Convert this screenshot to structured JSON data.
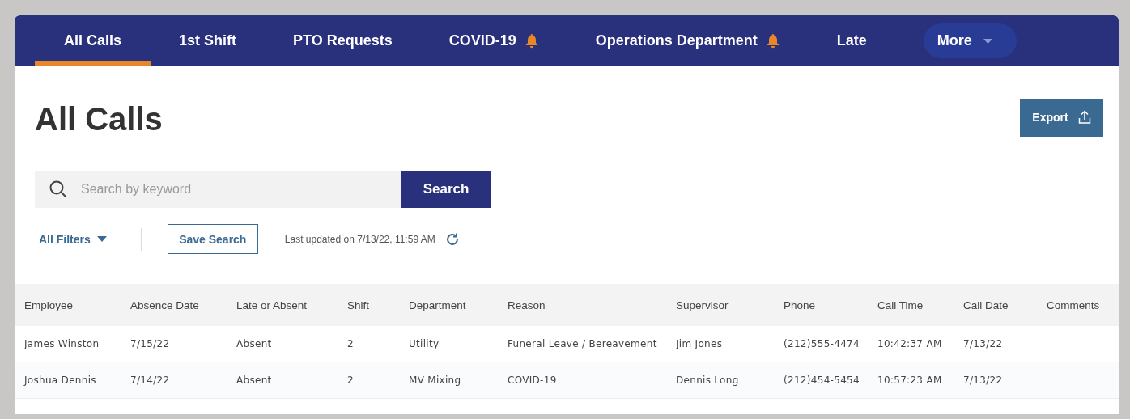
{
  "tabs": [
    {
      "label": "All Calls",
      "selected": true,
      "alert": false,
      "kind": "tab"
    },
    {
      "label": "1st Shift",
      "selected": false,
      "alert": false,
      "kind": "tab"
    },
    {
      "label": "PTO Requests",
      "selected": false,
      "alert": false,
      "kind": "tab"
    },
    {
      "label": "COVID-19",
      "selected": false,
      "alert": true,
      "kind": "tab"
    },
    {
      "label": "Operations Department",
      "selected": false,
      "alert": true,
      "kind": "tab"
    },
    {
      "label": "Late",
      "selected": false,
      "alert": false,
      "kind": "tab"
    },
    {
      "label": "More",
      "selected": false,
      "alert": false,
      "kind": "menu"
    }
  ],
  "page_title": "All Calls",
  "export_button": "Export",
  "search": {
    "placeholder": "Search by keyword",
    "button": "Search"
  },
  "filters": {
    "label": "All Filters",
    "save_button": "Save Search",
    "last_updated": "Last updated on 7/13/22, 11:59 AM"
  },
  "table": {
    "columns": [
      "Employee",
      "Absence Date",
      "Late or Absent",
      "Shift",
      "Department",
      "Reason",
      "Supervisor",
      "Phone",
      "Call Time",
      "Call Date",
      "Comments"
    ],
    "rows": [
      [
        "James Winston",
        "7/15/22",
        "Absent",
        "2",
        "Utility",
        "Funeral Leave / Bereavement",
        "Jim Jones",
        "(212)555-4474",
        "10:42:37 AM",
        "7/13/22"
      ],
      [
        "Joshua Dennis",
        "7/14/22",
        "Absent",
        "2",
        "MV Mixing",
        "COVID-19",
        "Dennis Long",
        "(212)454-5454",
        "10:57:23 AM",
        "7/13/22"
      ]
    ]
  }
}
